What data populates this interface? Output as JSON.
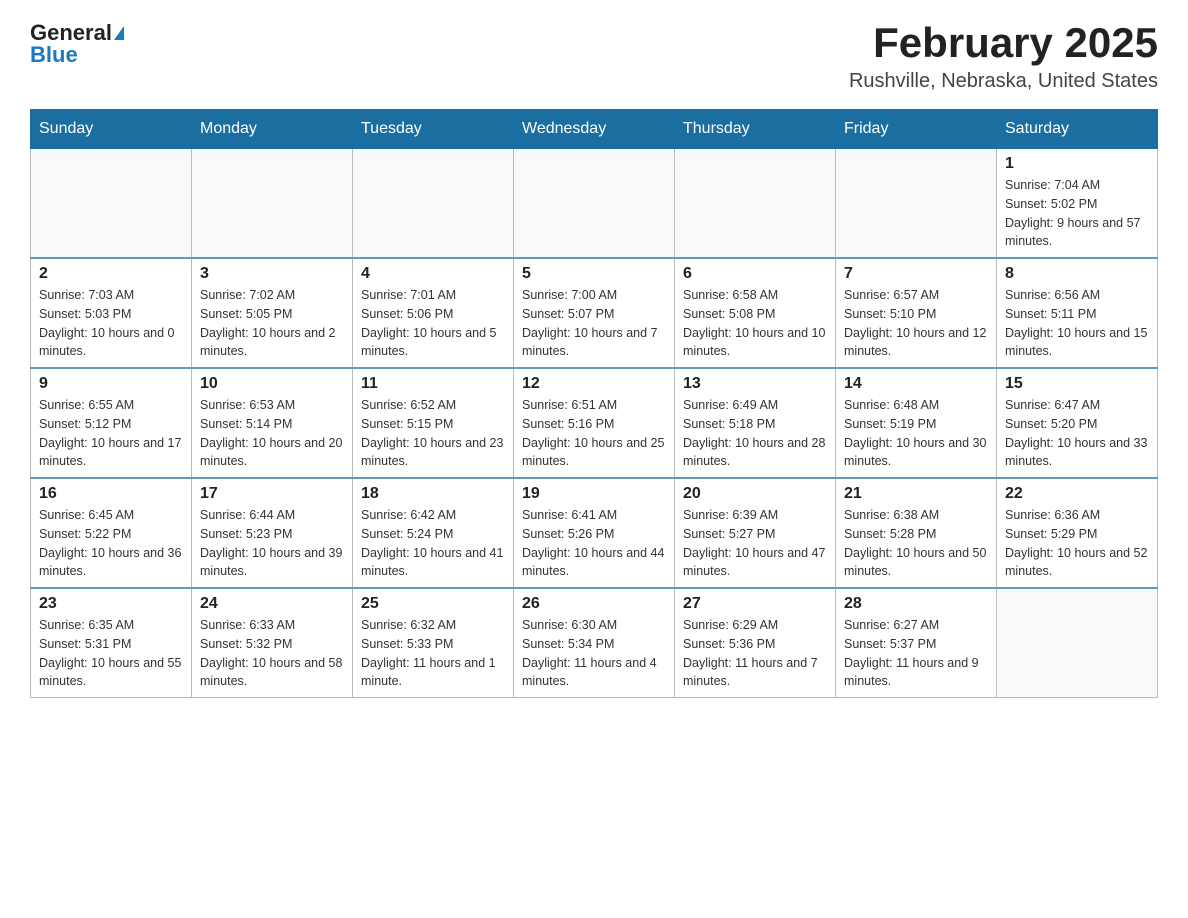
{
  "header": {
    "logo_main": "General",
    "logo_accent": "Blue",
    "title": "February 2025",
    "subtitle": "Rushville, Nebraska, United States"
  },
  "days_of_week": [
    "Sunday",
    "Monday",
    "Tuesday",
    "Wednesday",
    "Thursday",
    "Friday",
    "Saturday"
  ],
  "weeks": [
    [
      {
        "day": "",
        "info": ""
      },
      {
        "day": "",
        "info": ""
      },
      {
        "day": "",
        "info": ""
      },
      {
        "day": "",
        "info": ""
      },
      {
        "day": "",
        "info": ""
      },
      {
        "day": "",
        "info": ""
      },
      {
        "day": "1",
        "info": "Sunrise: 7:04 AM\nSunset: 5:02 PM\nDaylight: 9 hours and 57 minutes."
      }
    ],
    [
      {
        "day": "2",
        "info": "Sunrise: 7:03 AM\nSunset: 5:03 PM\nDaylight: 10 hours and 0 minutes."
      },
      {
        "day": "3",
        "info": "Sunrise: 7:02 AM\nSunset: 5:05 PM\nDaylight: 10 hours and 2 minutes."
      },
      {
        "day": "4",
        "info": "Sunrise: 7:01 AM\nSunset: 5:06 PM\nDaylight: 10 hours and 5 minutes."
      },
      {
        "day": "5",
        "info": "Sunrise: 7:00 AM\nSunset: 5:07 PM\nDaylight: 10 hours and 7 minutes."
      },
      {
        "day": "6",
        "info": "Sunrise: 6:58 AM\nSunset: 5:08 PM\nDaylight: 10 hours and 10 minutes."
      },
      {
        "day": "7",
        "info": "Sunrise: 6:57 AM\nSunset: 5:10 PM\nDaylight: 10 hours and 12 minutes."
      },
      {
        "day": "8",
        "info": "Sunrise: 6:56 AM\nSunset: 5:11 PM\nDaylight: 10 hours and 15 minutes."
      }
    ],
    [
      {
        "day": "9",
        "info": "Sunrise: 6:55 AM\nSunset: 5:12 PM\nDaylight: 10 hours and 17 minutes."
      },
      {
        "day": "10",
        "info": "Sunrise: 6:53 AM\nSunset: 5:14 PM\nDaylight: 10 hours and 20 minutes."
      },
      {
        "day": "11",
        "info": "Sunrise: 6:52 AM\nSunset: 5:15 PM\nDaylight: 10 hours and 23 minutes."
      },
      {
        "day": "12",
        "info": "Sunrise: 6:51 AM\nSunset: 5:16 PM\nDaylight: 10 hours and 25 minutes."
      },
      {
        "day": "13",
        "info": "Sunrise: 6:49 AM\nSunset: 5:18 PM\nDaylight: 10 hours and 28 minutes."
      },
      {
        "day": "14",
        "info": "Sunrise: 6:48 AM\nSunset: 5:19 PM\nDaylight: 10 hours and 30 minutes."
      },
      {
        "day": "15",
        "info": "Sunrise: 6:47 AM\nSunset: 5:20 PM\nDaylight: 10 hours and 33 minutes."
      }
    ],
    [
      {
        "day": "16",
        "info": "Sunrise: 6:45 AM\nSunset: 5:22 PM\nDaylight: 10 hours and 36 minutes."
      },
      {
        "day": "17",
        "info": "Sunrise: 6:44 AM\nSunset: 5:23 PM\nDaylight: 10 hours and 39 minutes."
      },
      {
        "day": "18",
        "info": "Sunrise: 6:42 AM\nSunset: 5:24 PM\nDaylight: 10 hours and 41 minutes."
      },
      {
        "day": "19",
        "info": "Sunrise: 6:41 AM\nSunset: 5:26 PM\nDaylight: 10 hours and 44 minutes."
      },
      {
        "day": "20",
        "info": "Sunrise: 6:39 AM\nSunset: 5:27 PM\nDaylight: 10 hours and 47 minutes."
      },
      {
        "day": "21",
        "info": "Sunrise: 6:38 AM\nSunset: 5:28 PM\nDaylight: 10 hours and 50 minutes."
      },
      {
        "day": "22",
        "info": "Sunrise: 6:36 AM\nSunset: 5:29 PM\nDaylight: 10 hours and 52 minutes."
      }
    ],
    [
      {
        "day": "23",
        "info": "Sunrise: 6:35 AM\nSunset: 5:31 PM\nDaylight: 10 hours and 55 minutes."
      },
      {
        "day": "24",
        "info": "Sunrise: 6:33 AM\nSunset: 5:32 PM\nDaylight: 10 hours and 58 minutes."
      },
      {
        "day": "25",
        "info": "Sunrise: 6:32 AM\nSunset: 5:33 PM\nDaylight: 11 hours and 1 minute."
      },
      {
        "day": "26",
        "info": "Sunrise: 6:30 AM\nSunset: 5:34 PM\nDaylight: 11 hours and 4 minutes."
      },
      {
        "day": "27",
        "info": "Sunrise: 6:29 AM\nSunset: 5:36 PM\nDaylight: 11 hours and 7 minutes."
      },
      {
        "day": "28",
        "info": "Sunrise: 6:27 AM\nSunset: 5:37 PM\nDaylight: 11 hours and 9 minutes."
      },
      {
        "day": "",
        "info": ""
      }
    ]
  ]
}
